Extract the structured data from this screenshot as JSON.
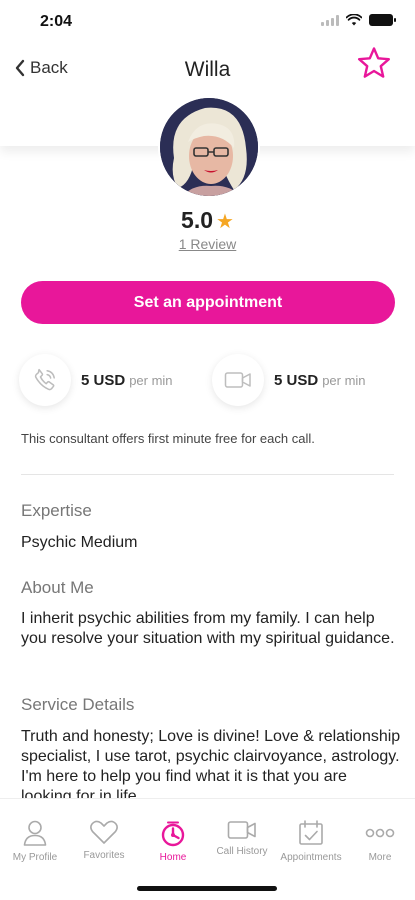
{
  "status": {
    "time": "2:04"
  },
  "header": {
    "back_label": "Back",
    "title": "Willa"
  },
  "profile": {
    "rating": "5.0",
    "rating_star": "★",
    "reviews": "1 Review"
  },
  "appointment": {
    "button_label": "Set an appointment"
  },
  "rates": {
    "call": {
      "price": "5 USD",
      "unit": "per min",
      "icon": "phone-icon"
    },
    "video": {
      "price": "5 USD",
      "unit": "per min",
      "icon": "video-icon"
    }
  },
  "free_note": "This consultant offers first minute free for each call.",
  "sections": {
    "expertise": {
      "heading": "Expertise",
      "value": "Psychic Medium"
    },
    "about": {
      "heading": "About Me",
      "value": "I inherit psychic abilities from my family. I can help you resolve your situation with my spiritual guidance."
    },
    "service": {
      "heading": "Service Details",
      "value": "Truth and honesty; Love is divine! Love & relationship specialist, I use tarot, psychic clairvoyance, astrology. I'm here to help you find what it is that you are looking for in life"
    }
  },
  "tabs": [
    {
      "label": "My Profile",
      "icon": "person-icon"
    },
    {
      "label": "Favorites",
      "icon": "heart-icon"
    },
    {
      "label": "Home",
      "icon": "home-icon",
      "active": true
    },
    {
      "label": "Call History",
      "icon": "video-camera-icon"
    },
    {
      "label": "Appointments",
      "icon": "calendar-icon"
    },
    {
      "label": "More",
      "icon": "more-icon"
    }
  ],
  "colors": {
    "accent": "#e8179a",
    "star": "#f5a623"
  }
}
